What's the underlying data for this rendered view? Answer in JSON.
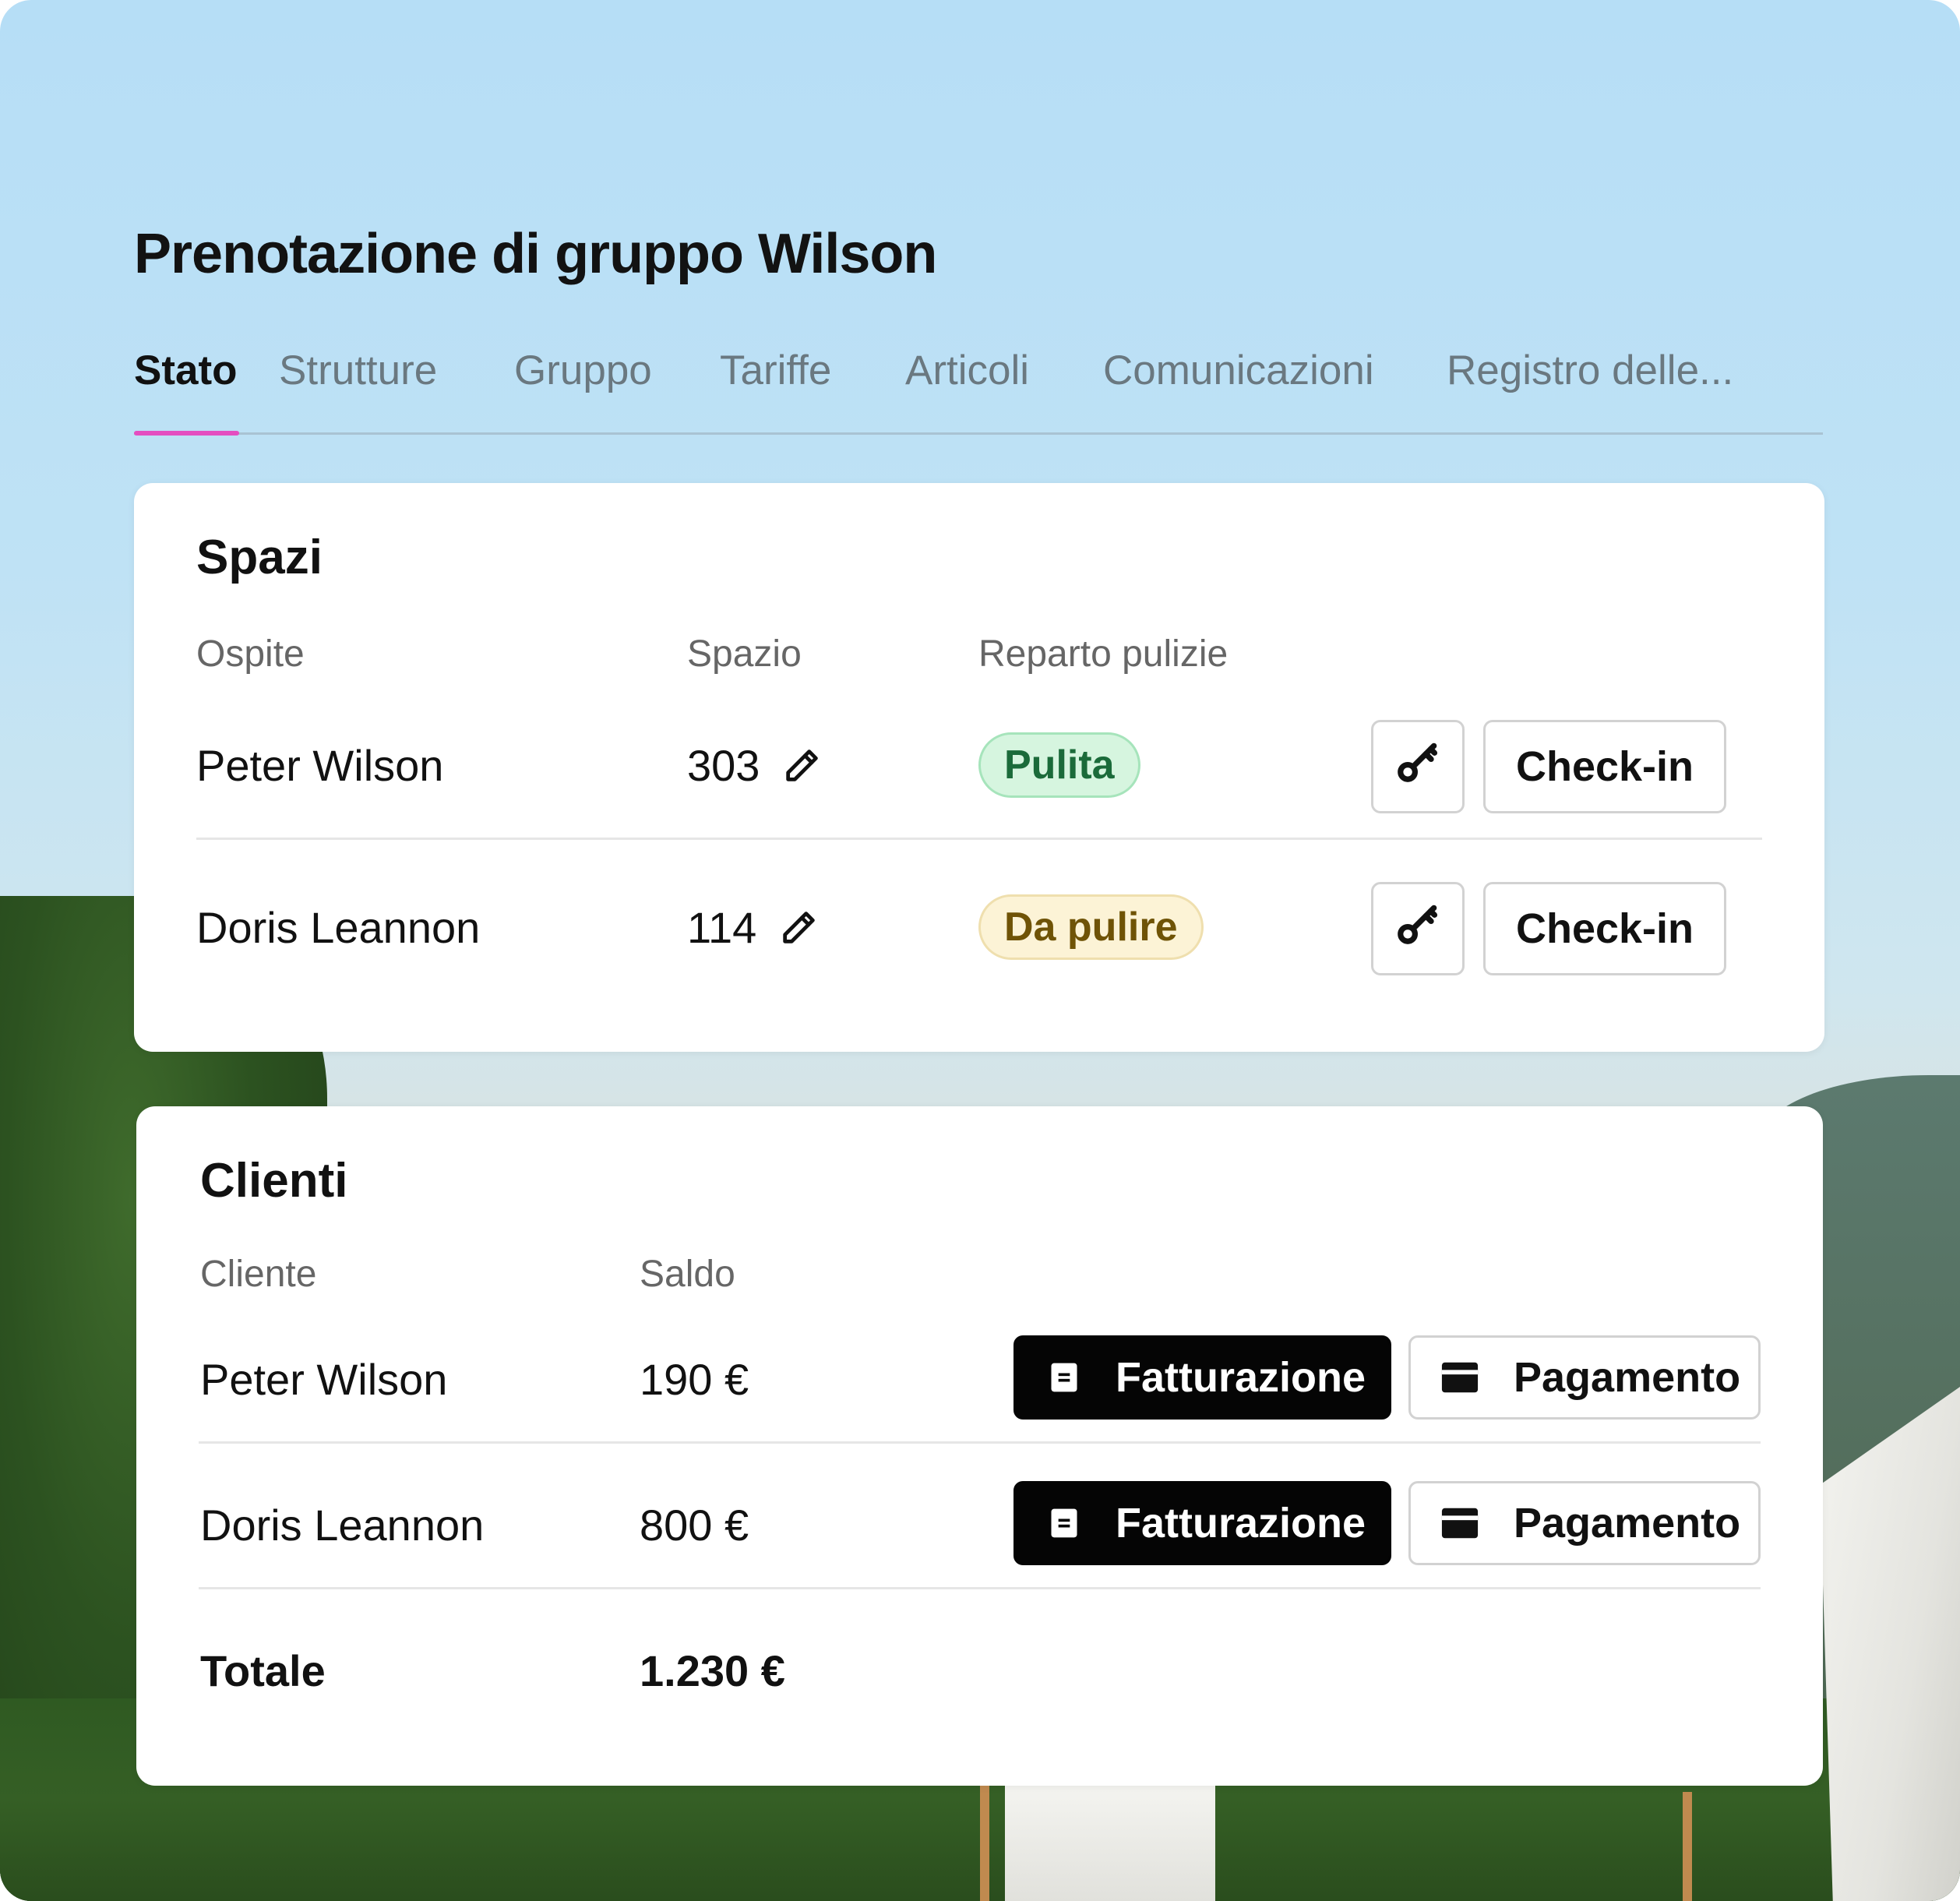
{
  "header": {
    "title": "Prenotazione di gruppo Wilson"
  },
  "tabs": [
    {
      "label": "Stato",
      "active": true
    },
    {
      "label": "Strutture"
    },
    {
      "label": "Gruppo"
    },
    {
      "label": "Tariffe"
    },
    {
      "label": "Articoli"
    },
    {
      "label": "Comunicazioni"
    },
    {
      "label": "Registro delle..."
    }
  ],
  "spaces": {
    "title": "Spazi",
    "columns": [
      "Ospite",
      "Spazio",
      "Reparto pulizie"
    ],
    "rows": [
      {
        "guest": "Peter Wilson",
        "room": "303",
        "housekeeping": "Pulita",
        "status": "clean",
        "action": "Check-in"
      },
      {
        "guest": "Doris Leannon",
        "room": "114",
        "housekeeping": "Da pulire",
        "status": "dirty",
        "action": "Check-in"
      }
    ]
  },
  "clients": {
    "title": "Clienti",
    "columns": [
      "Cliente",
      "Saldo"
    ],
    "rows": [
      {
        "client": "Peter Wilson",
        "balance": "190 €",
        "billing": "Fatturazione",
        "payment": "Pagamento"
      },
      {
        "client": "Doris Leannon",
        "balance": "800 €",
        "billing": "Fatturazione",
        "payment": "Pagamento"
      }
    ],
    "total_label": "Totale",
    "total_value": "1.230 €"
  },
  "icons": {
    "edit": "pencil-icon",
    "key": "key-icon",
    "billing": "document-icon",
    "payment": "credit-card-icon"
  },
  "colors": {
    "accent": "#e44ec0",
    "clean_bg": "#d6f5df",
    "clean_text": "#1b6b3a",
    "dirty_bg": "#fcf3d6",
    "dirty_text": "#6f5306",
    "primary_button": "#050505"
  }
}
